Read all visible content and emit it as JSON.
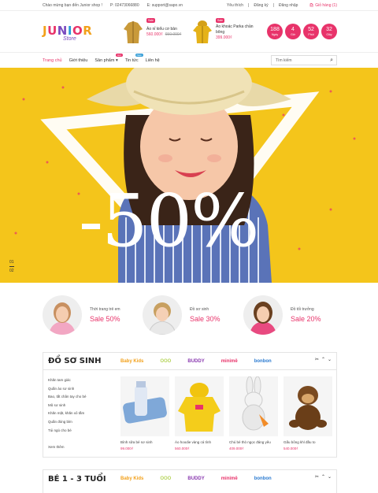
{
  "topbar": {
    "welcome": "Chào mừng bạn đến Junior shop !",
    "phone": "P: 02473066880",
    "email": "E: support@sapo.vn",
    "wishlist": "Yêu thích",
    "register": "Đăng ký",
    "login": "Đăng nhập",
    "cart": "Giỏ hàng (1)"
  },
  "logo": {
    "word": "JUNIOR",
    "sub": "Store"
  },
  "featured": [
    {
      "badge": "Sale",
      "name": "Áo nỉ kiểu cơ bản",
      "price": "560.000₫",
      "old_price": "650.000₫"
    },
    {
      "badge": "Sale",
      "name": "Áo khoác Parka chần bông",
      "price": "399.000₫",
      "old_price": ""
    }
  ],
  "countdown": [
    {
      "value": "188",
      "unit": "Ngày"
    },
    {
      "value": "4",
      "unit": "Giờ"
    },
    {
      "value": "52",
      "unit": "Phút"
    },
    {
      "value": "32",
      "unit": "Giây"
    }
  ],
  "nav": {
    "items": [
      {
        "label": "Trang chủ",
        "badge": ""
      },
      {
        "label": "Giới thiệu",
        "badge": ""
      },
      {
        "label": "Sản phẩm",
        "badge": "Hot"
      },
      {
        "label": "Tin tức",
        "badge": "New"
      },
      {
        "label": "Liên hệ",
        "badge": ""
      }
    ],
    "search_placeholder": "Tìm kiếm"
  },
  "hero": {
    "discount": "-50%",
    "slides": [
      "01",
      "02"
    ]
  },
  "promos": [
    {
      "title": "Thời trang trẻ em",
      "sale": "Sale 50%"
    },
    {
      "title": "Đồ sơ sinh",
      "sale": "Sale 30%"
    },
    {
      "title": "Đồ tối trưởng",
      "sale": "Sale 20%"
    }
  ],
  "section1": {
    "title": "ĐỒ SƠ SINH",
    "brands": [
      "Baby Kids",
      "OOO",
      "BUDDY",
      "minimë",
      "bonbon"
    ],
    "categories": [
      "Khăn tam giác",
      "Quần áo sơ sinh",
      "Bao, tất chân tay cho bé",
      "Mũ sơ sinh",
      "Khăn mặt, khăn xô tắm",
      "Quần đóng bỉm",
      "Túi ngủ cho bé",
      "",
      "Xem thêm"
    ],
    "products": [
      {
        "name": "Bình sữa bé sơ sinh",
        "price": "99.000₫"
      },
      {
        "name": "Áo hoodie vàng cá tính",
        "price": "560.000₫"
      },
      {
        "name": "Chú bé thỏ ngọc đáng yêu",
        "price": "409.000₫"
      },
      {
        "name": "Gấu bông khỉ đầu to",
        "price": "540.000₫"
      }
    ]
  },
  "section2": {
    "title": "BÉ 1 - 3 TUỔI",
    "brands": [
      "Baby Kids",
      "OOO",
      "BUDDY",
      "minimë",
      "bonbon"
    ]
  },
  "colors": {
    "accent": "#e8336a",
    "hero_bg": "#f4c51b"
  }
}
